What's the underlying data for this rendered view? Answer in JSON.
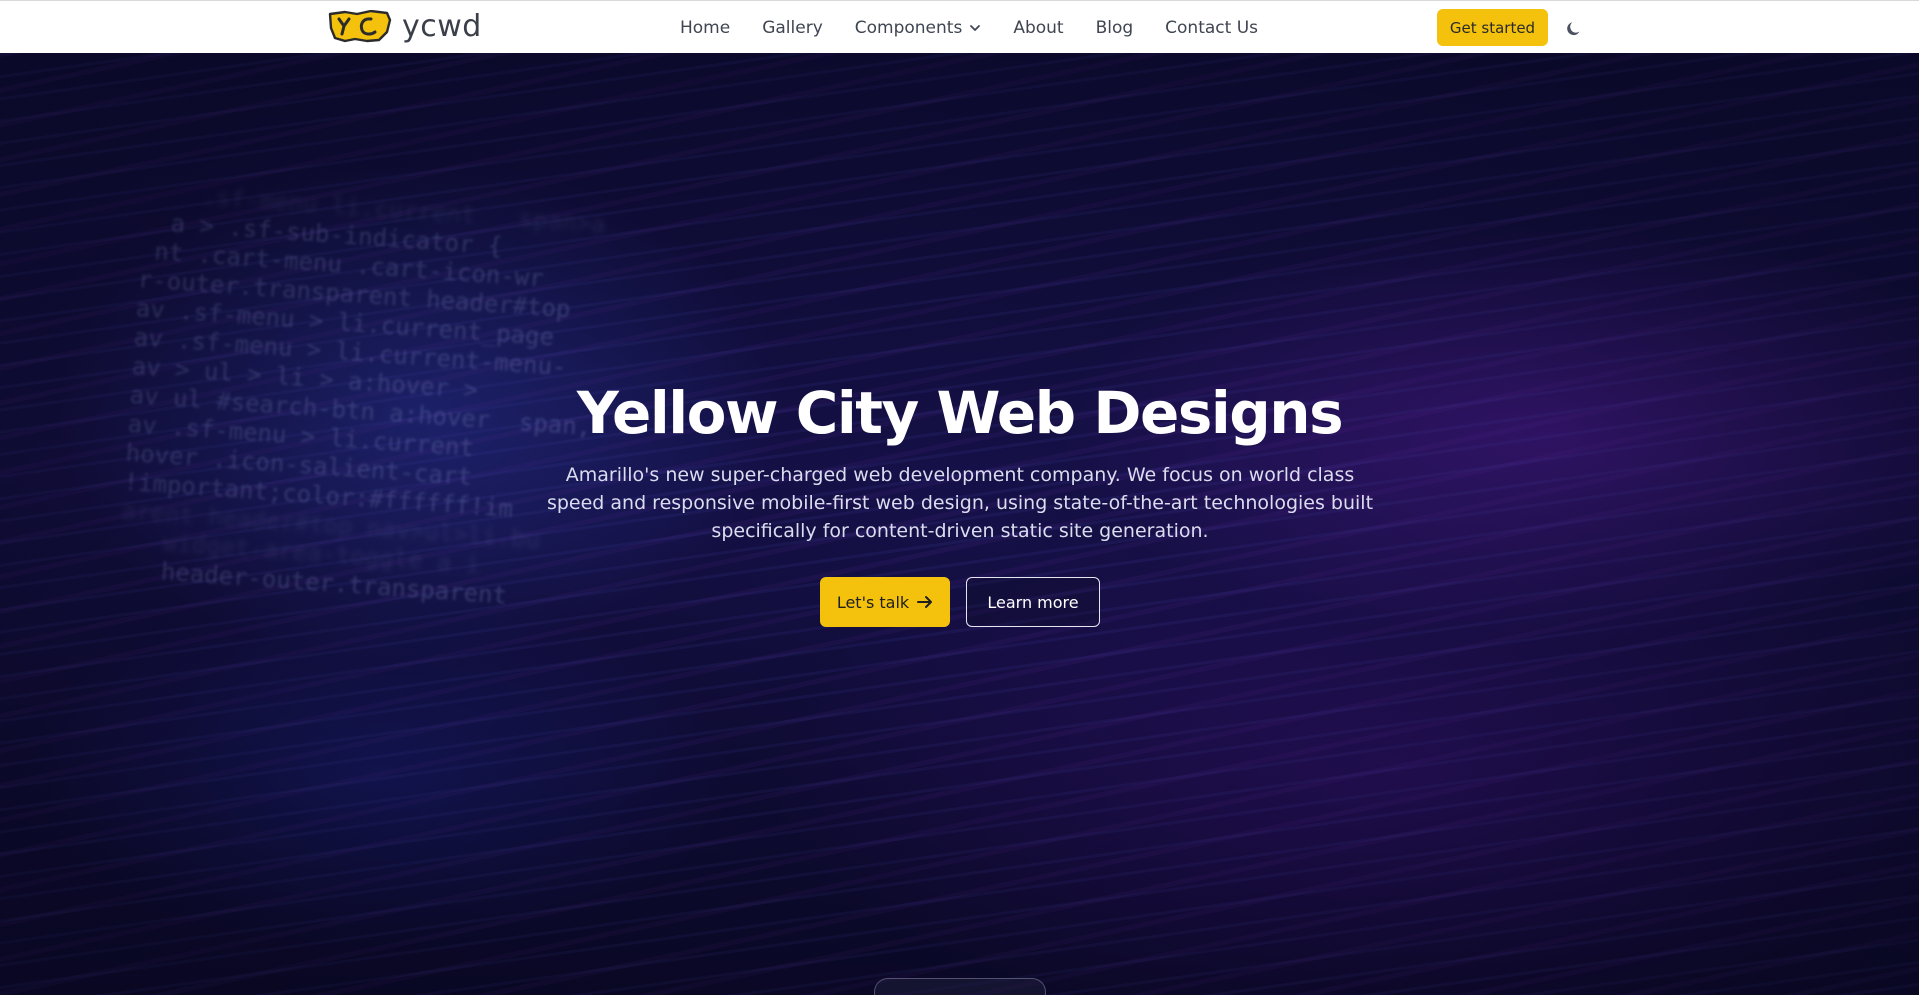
{
  "header": {
    "logo": {
      "mark_icon": "yc-logo-icon",
      "text": "ycwd"
    },
    "nav": [
      {
        "label": "Home"
      },
      {
        "label": "Gallery"
      },
      {
        "label": "Components",
        "dropdown": true
      },
      {
        "label": "About"
      },
      {
        "label": "Blog"
      },
      {
        "label": "Contact Us"
      }
    ],
    "cta_label": "Get started",
    "theme_toggle_icon": "moon-icon"
  },
  "hero": {
    "title": "Yellow City Web Designs",
    "subtitle": "Amarillo's new super-charged web development company. We focus on world class speed and responsive mobile-first web design, using state-of-the-art technologies built specifically for content-driven static site generation.",
    "primary_button": {
      "label": "Let's talk",
      "icon": "arrow-right-icon"
    },
    "secondary_button": {
      "label": "Learn more"
    }
  },
  "colors": {
    "accent": "#f4c20d",
    "header_bg": "#ffffff",
    "nav_text": "#3f4551",
    "hero_bg": "#16114a",
    "hero_text": "#ffffff"
  }
}
